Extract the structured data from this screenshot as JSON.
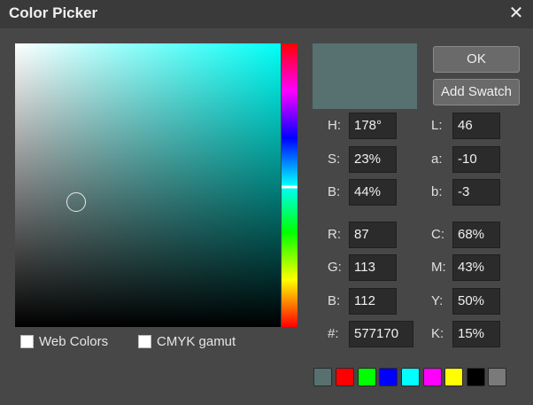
{
  "window": {
    "title": "Color Picker"
  },
  "icons": {
    "close": "close-icon"
  },
  "picker": {
    "hue_degrees": 178,
    "saturation_percent": 23,
    "brightness_percent": 44,
    "cursor_color": "#e8e8e8",
    "hue_marker_color": "#ffffff"
  },
  "options": {
    "web_colors_label": "Web Colors",
    "web_colors_checked": false,
    "cmyk_gamut_label": "CMYK gamut",
    "cmyk_gamut_checked": false
  },
  "preview_color": "#577170",
  "buttons": {
    "ok_label": "OK",
    "add_swatch_label": "Add Swatch"
  },
  "fields": {
    "hsb": [
      {
        "label": "H:",
        "value": "178°"
      },
      {
        "label": "S:",
        "value": "23%"
      },
      {
        "label": "B:",
        "value": "44%"
      }
    ],
    "lab": [
      {
        "label": "L:",
        "value": "46"
      },
      {
        "label": "a:",
        "value": "-10"
      },
      {
        "label": "b:",
        "value": "-3"
      }
    ],
    "rgb": [
      {
        "label": "R:",
        "value": "87"
      },
      {
        "label": "G:",
        "value": "113"
      },
      {
        "label": "B:",
        "value": "112"
      }
    ],
    "hex": {
      "label": "#:",
      "value": "577170"
    },
    "cmyk": [
      {
        "label": "C:",
        "value": "68%"
      },
      {
        "label": "M:",
        "value": "43%"
      },
      {
        "label": "Y:",
        "value": "50%"
      },
      {
        "label": "K:",
        "value": "15%"
      }
    ]
  },
  "swatches": [
    "#577170",
    "#ff0000",
    "#00ff00",
    "#0000ff",
    "#00ffff",
    "#ff00ff",
    "#ffff00",
    "#000000",
    "#7a7a7a"
  ]
}
